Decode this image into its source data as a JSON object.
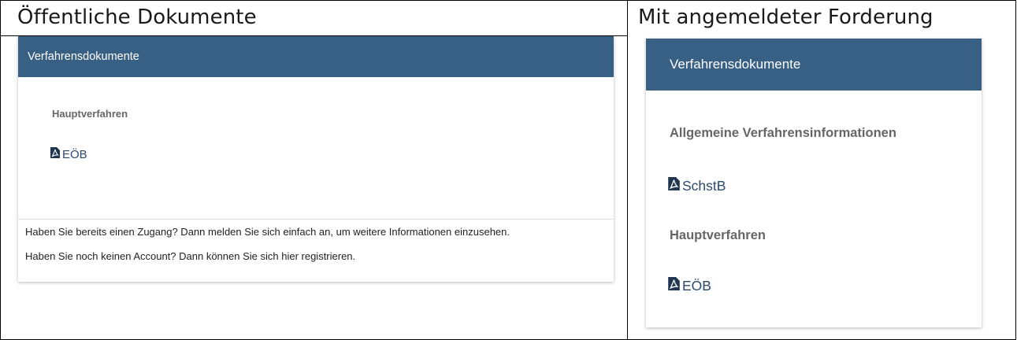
{
  "left_column": {
    "title": "Öffentliche Dokumente",
    "card": {
      "header": "Verfahrensdokumente",
      "section_label": "Hauptverfahren",
      "documents": [
        {
          "label": "EÖB",
          "icon": "pdf-file-icon"
        }
      ],
      "info_lines": [
        "Haben Sie bereits einen Zugang? Dann melden Sie sich einfach an, um weitere Informationen einzusehen.",
        "Haben Sie noch keinen Account? Dann können Sie sich hier registrieren."
      ]
    }
  },
  "right_column": {
    "title": "Mit angemeldeter Forderung",
    "card": {
      "header": "Verfahrensdokumente",
      "sections": [
        {
          "label": "Allgemeine Verfahrensinformationen",
          "documents": [
            {
              "label": "SchstB",
              "icon": "pdf-file-icon"
            }
          ]
        },
        {
          "label": "Hauptverfahren",
          "documents": [
            {
              "label": "EÖB",
              "icon": "pdf-file-icon"
            }
          ]
        }
      ]
    }
  },
  "colors": {
    "header_bg": "#385f84",
    "header_text": "#ffffff",
    "link_text": "#2c4a6b",
    "section_label": "#666666"
  }
}
